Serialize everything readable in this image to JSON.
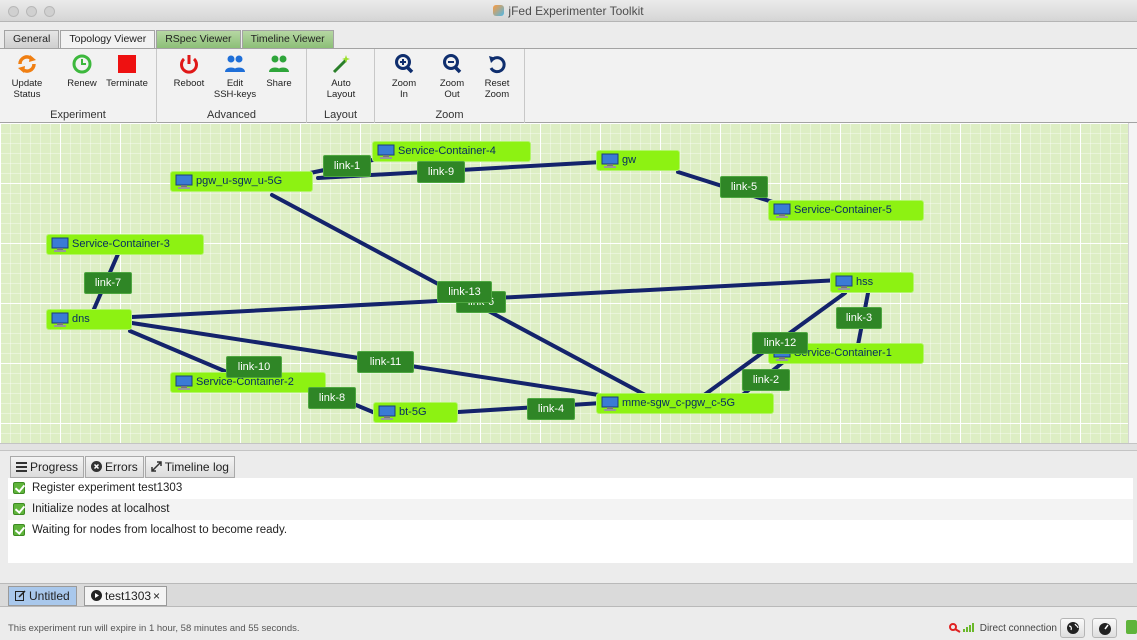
{
  "window": {
    "title": "jFed Experimenter Toolkit"
  },
  "tabs": [
    {
      "label": "General"
    },
    {
      "label": "Topology Viewer"
    },
    {
      "label": "RSpec Viewer"
    },
    {
      "label": "Timeline Viewer"
    }
  ],
  "ribbon": {
    "groups": {
      "experiment": "Experiment",
      "advanced": "Advanced",
      "layout": "Layout",
      "zoom": "Zoom"
    },
    "buttons": {
      "update_status": [
        "Update",
        "Status"
      ],
      "renew": [
        "Renew"
      ],
      "terminate": [
        "Terminate"
      ],
      "reboot": [
        "Reboot"
      ],
      "edit_ssh_keys": [
        "Edit",
        "SSH-keys"
      ],
      "share": [
        "Share"
      ],
      "auto_layout": [
        "Auto",
        "Layout"
      ],
      "zoom_in": [
        "Zoom",
        "In"
      ],
      "zoom_out": [
        "Zoom",
        "Out"
      ],
      "reset_zoom": [
        "Reset",
        "Zoom"
      ]
    }
  },
  "topology": {
    "nodes": {
      "pgw": "pgw_u-sgw_u-5G",
      "sc4": "Service-Container-4",
      "gw": "gw",
      "sc5": "Service-Container-5",
      "sc3": "Service-Container-3",
      "dns": "dns",
      "hss": "hss",
      "sc1": "Service-Container-1",
      "sc2": "Service-Container-2",
      "bt": "bt-5G",
      "mme": "mme-sgw_c-pgw_c-5G"
    },
    "links": {
      "link1": "link-1",
      "link9": "link-9",
      "link5": "link-5",
      "link7": "link-7",
      "link6": "link-6",
      "link13": "link-13",
      "link3": "link-3",
      "link12": "link-12",
      "link2": "link-2",
      "link10": "link-10",
      "link11": "link-11",
      "link8": "link-8",
      "link4": "link-4"
    }
  },
  "log": {
    "tabs": {
      "progress": "Progress",
      "errors": "Errors",
      "timeline": "Timeline log"
    },
    "items": [
      "Register experiment test1303",
      "Initialize nodes at localhost",
      "Waiting for nodes from localhost to become ready."
    ]
  },
  "experiment_tabs": {
    "untitled": "Untitled",
    "test": "test1303",
    "close": "×"
  },
  "status": {
    "text": "This experiment run will expire in 1 hour, 58 minutes and 55 seconds.",
    "connection": "Direct connection"
  },
  "colors": {
    "node": "#8df212",
    "link": "#2f8626",
    "edge": "#14236b",
    "canvas": "#ddeec4"
  }
}
